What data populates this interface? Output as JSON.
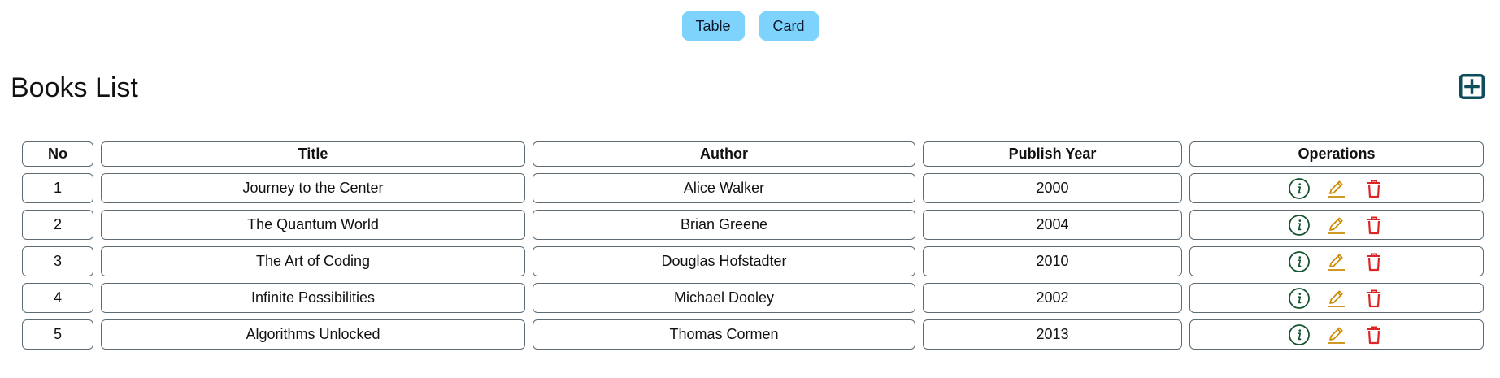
{
  "view_toggle": {
    "table_label": "Table",
    "card_label": "Card"
  },
  "header": {
    "title": "Books List",
    "add_icon": "plus-square-icon"
  },
  "table": {
    "columns": [
      "No",
      "Title",
      "Author",
      "Publish Year",
      "Operations"
    ],
    "rows": [
      {
        "no": "1",
        "title": "Journey to the Center",
        "author": "Alice Walker",
        "year": "2000"
      },
      {
        "no": "2",
        "title": "The Quantum World",
        "author": "Brian Greene",
        "year": "2004"
      },
      {
        "no": "3",
        "title": "The Art of Coding",
        "author": "Douglas Hofstadter",
        "year": "2010"
      },
      {
        "no": "4",
        "title": "Infinite Possibilities",
        "author": "Michael Dooley",
        "year": "2002"
      },
      {
        "no": "5",
        "title": "Algorithms Unlocked",
        "author": "Thomas Cormen",
        "year": "2013"
      }
    ],
    "operation_icons": [
      "info-circle-icon",
      "pencil-edit-icon",
      "trash-delete-icon"
    ]
  },
  "colors": {
    "toggle_button": "#7dd3fc",
    "add_icon": "#0f4c5c",
    "info_icon": "#14532d",
    "edit_icon": "#ca8a04",
    "delete_icon": "#dc2626",
    "cell_border": "#5f6b73"
  }
}
